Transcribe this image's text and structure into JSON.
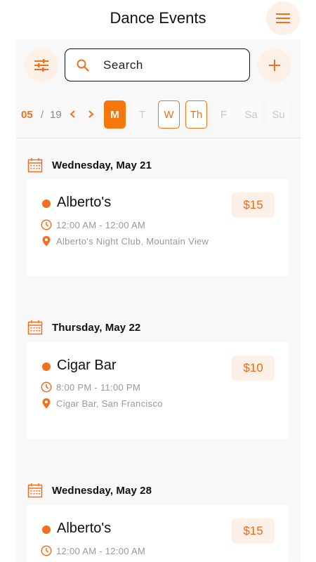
{
  "header": {
    "title": "Dance Events"
  },
  "search": {
    "placeholder": "Search",
    "value": ""
  },
  "date_nav": {
    "month": "05",
    "separator": "/",
    "year": "19"
  },
  "days": [
    {
      "label": "M",
      "state": "active"
    },
    {
      "label": "T",
      "state": "inactive"
    },
    {
      "label": "W",
      "state": "outlined"
    },
    {
      "label": "Th",
      "state": "outlined"
    },
    {
      "label": "F",
      "state": "inactive"
    },
    {
      "label": "Sa",
      "state": "inactive"
    },
    {
      "label": "Su",
      "state": "inactive"
    }
  ],
  "groups": [
    {
      "date": "Wednesday, May 21",
      "event": {
        "name": "Alberto's",
        "time": "12:00 AM - 12:00 AM",
        "location": "Alberto's Night Club, Mountain View",
        "price": "$15"
      }
    },
    {
      "date": "Thursday, May 22",
      "event": {
        "name": "Cigar Bar",
        "time": "8:00 PM - 11:00 PM",
        "location": "Cigar Bar, San Francisco",
        "price": "$10"
      }
    },
    {
      "date": "Wednesday, May 28",
      "event": {
        "name": "Alberto's",
        "time": "12:00 AM - 12:00 AM",
        "location": "",
        "price": "$15"
      }
    }
  ],
  "colors": {
    "accent": "#f07020",
    "accent_light": "#fdf0e6",
    "panel_bg": "#f8f8f8"
  },
  "icons": [
    "menu-icon",
    "filter-icon",
    "search-icon",
    "plus-icon",
    "chevron-left-icon",
    "chevron-right-icon",
    "calendar-icon",
    "clock-icon",
    "location-pin-icon"
  ]
}
